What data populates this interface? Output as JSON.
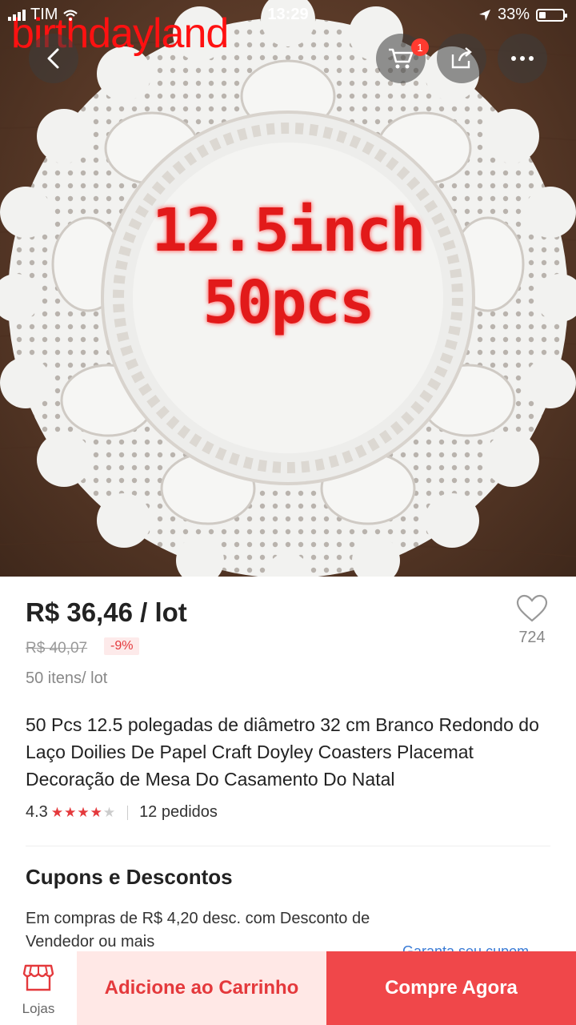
{
  "status_bar": {
    "carrier": "TIM",
    "time": "13:29",
    "battery": "33%"
  },
  "hero": {
    "watermark": "birthdayland",
    "banner_line1": "12.5inch",
    "banner_line2": "50pcs"
  },
  "nav": {
    "cart_badge": "1",
    "icons": [
      "back-chevron-icon",
      "cart-icon",
      "share-icon",
      "more-icon"
    ]
  },
  "product": {
    "price": "R$ 36,46 / lot",
    "old_price": "R$ 40,07",
    "discount": "-9%",
    "unit_info": "50 itens/ lot",
    "wishlist_count": "724",
    "title": "50 Pcs 12.5 polegadas de diâmetro 32 cm Branco Redondo do Laço Doilies De Papel Craft Doyley Coasters Placemat Decoração de Mesa Do Casamento Do Natal",
    "rating": "4.3",
    "stars_filled": 4,
    "orders": "12 pedidos"
  },
  "coupons": {
    "title": "Cupons e Descontos",
    "text": "Em compras de R$ 4,20 desc. com Desconto de Vendedor ou mais",
    "link": "Garanta seu cupom"
  },
  "bottom_bar": {
    "stores_label": "Lojas",
    "add_to_cart": "Adicione ao Carrinho",
    "buy_now": "Compre Agora"
  },
  "colors": {
    "accent": "#e4393c",
    "buy_button": "#f0474a",
    "cart_button_bg": "#ffe8e6"
  }
}
